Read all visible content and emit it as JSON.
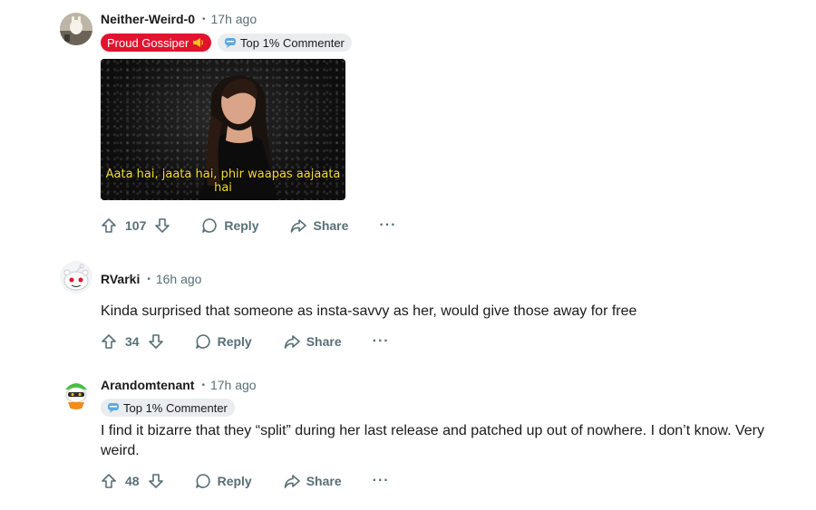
{
  "comments": [
    {
      "author": "Neither-Weird-0",
      "time": "17h ago",
      "flairs": [
        {
          "label": "Proud Gossiper",
          "style": "red",
          "icon": "megaphone-icon"
        },
        {
          "label": "Top 1% Commenter",
          "style": "grey",
          "icon": "chat-bubble-icon"
        }
      ],
      "gif_caption": "Aata hai, jaata hai, phir waapas aajaata hai",
      "votes": "107",
      "reply_label": "Reply",
      "share_label": "Share",
      "more_label": "···"
    },
    {
      "author": "RVarki",
      "time": "16h ago",
      "body": "Kinda surprised that someone as insta-savvy as her, would give those away for free",
      "votes": "34",
      "reply_label": "Reply",
      "share_label": "Share",
      "more_label": "···"
    },
    {
      "author": "Arandomtenant",
      "time": "17h ago",
      "flairs": [
        {
          "label": "Top 1% Commenter",
          "style": "grey",
          "icon": "chat-bubble-icon"
        }
      ],
      "body_line1": "I find it bizarre that they “split” during her last release and patched up out of nowhere. I don’t know. Very",
      "body_line2": "weird.",
      "votes": "48",
      "reply_label": "Reply",
      "share_label": "Share",
      "more_label": "···"
    }
  ],
  "colors": {
    "accent_red": "#e0142f",
    "meta_grey": "#576f76",
    "caption_yellow": "#f3de2c"
  }
}
